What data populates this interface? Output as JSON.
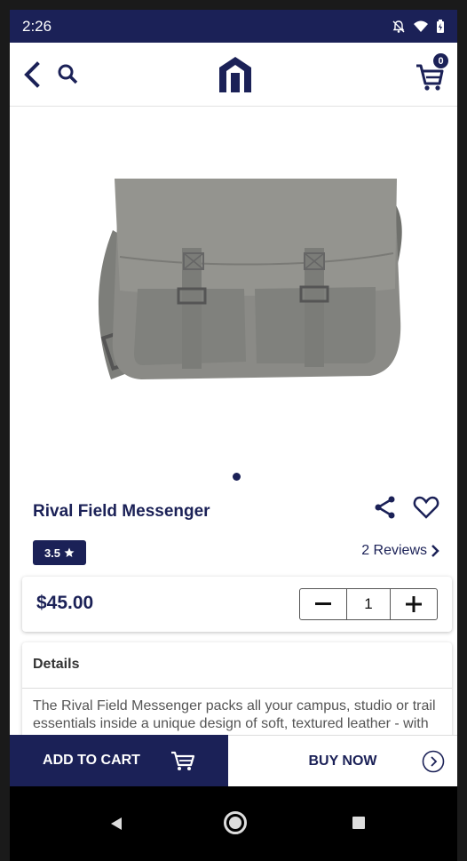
{
  "status_bar": {
    "time": "2:26",
    "icons": [
      "notifications-off-icon",
      "wifi-icon",
      "battery-icon"
    ]
  },
  "app_bar": {
    "cart_count": "0"
  },
  "product": {
    "title": "Rival Field Messenger",
    "rating": "3.5",
    "reviews_label": "2 Reviews",
    "price": "$45.00",
    "quantity": "1",
    "image_count": 1,
    "active_image": 1
  },
  "details": {
    "heading": "Details",
    "description": "The Rival Field Messenger packs all your campus, studio or trail essentials inside a unique design of soft, textured leather - with loads of character to spare. Two"
  },
  "actions": {
    "add_to_cart": "ADD TO CART",
    "buy_now": "BUY NOW"
  },
  "colors": {
    "brand": "#1b2157",
    "bag": "#8a8a86"
  }
}
